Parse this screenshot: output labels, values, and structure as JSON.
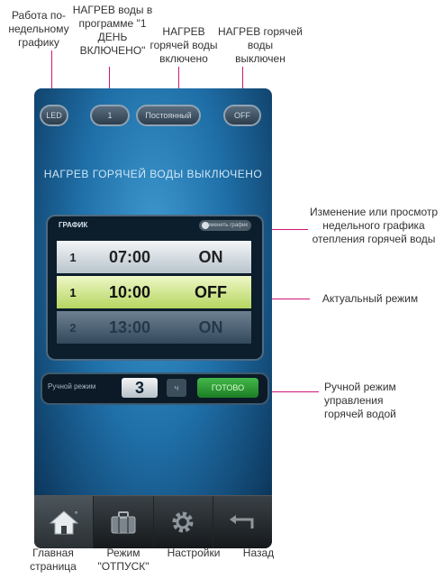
{
  "callouts": {
    "weekly": [
      "Работа по-",
      "недельному",
      "графику"
    ],
    "program": [
      "НАГРЕВ воды в",
      "программе \"1",
      "ДЕНЬ",
      "ВКЛЮЧЕНО\""
    ],
    "on": [
      "НАГРЕВ",
      "горячей воды",
      "включено"
    ],
    "off": [
      "НАГРЕВ горячей воды",
      "выключен"
    ],
    "edit": [
      "Изменение или просмотр",
      "недельного графика",
      "отепления горячей воды"
    ],
    "actual": [
      "Актуальный режим"
    ],
    "manual": [
      "Ручной режим управления",
      "горячей водой"
    ],
    "home": [
      "Главная",
      "страница"
    ],
    "vacation": [
      "Режим",
      "\"ОТПУСК\""
    ],
    "settings": [
      "Настройки"
    ],
    "back": [
      "Назад"
    ]
  },
  "device": {
    "pills": [
      "LED",
      "1",
      "Постоянный",
      "OFF"
    ],
    "heading": "НАГРЕВ ГОРЯЧЕЙ ВОДЫ ВЫКЛЮЧЕНО",
    "schedule": {
      "title": "ГРАФИК",
      "edit_label": "Изменить график",
      "rows": [
        {
          "day": "1",
          "time": "07:00",
          "state": "ON"
        },
        {
          "day": "1",
          "time": "10:00",
          "state": "OFF"
        },
        {
          "day": "2",
          "time": "13:00",
          "state": "ON"
        }
      ]
    },
    "manual": {
      "label": "Ручной режим",
      "value": "3",
      "unit": "ч",
      "ok": "ГОТОВО"
    }
  },
  "colors": {
    "accent_line": "#d0157a",
    "active_row": "#b5d660",
    "ok_button": "#2e9a36"
  },
  "icons": [
    "home-icon",
    "suitcase-icon",
    "gear-icon",
    "back-arrow-icon"
  ]
}
